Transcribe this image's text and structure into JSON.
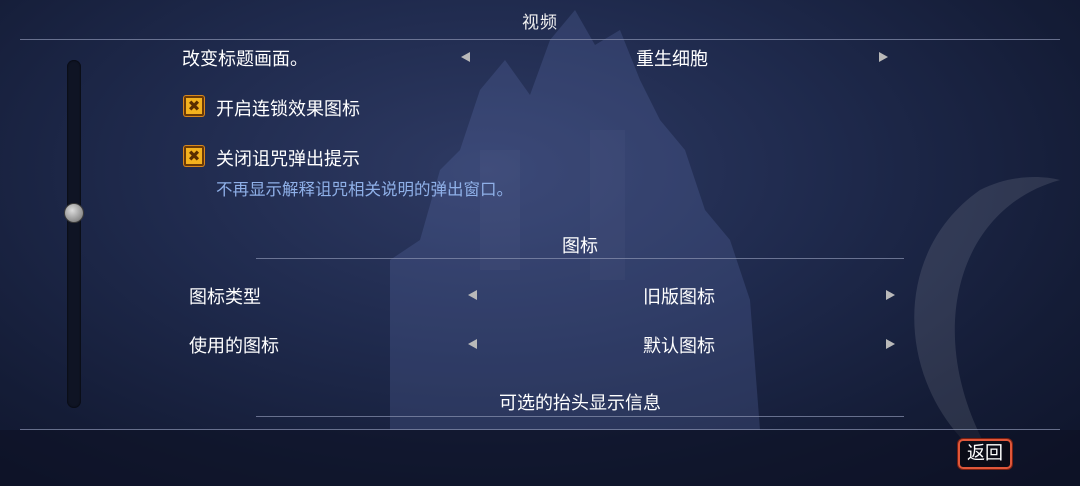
{
  "header": {
    "title": "视频"
  },
  "rows": {
    "title_screen": {
      "label": "改变标题画面。",
      "value": "重生细胞"
    },
    "chain_icons": {
      "label": "开启连锁效果图标",
      "checked": true
    },
    "curse_popup": {
      "label": "关闭诅咒弹出提示",
      "description": "不再显示解释诅咒相关说明的弹出窗口。",
      "checked": true
    }
  },
  "sections": {
    "icons": {
      "title": "图标",
      "icon_type": {
        "label": "图标类型",
        "value": "旧版图标"
      },
      "icon_used": {
        "label": "使用的图标",
        "value": "默认图标"
      }
    },
    "hud": {
      "title": "可选的抬头显示信息"
    }
  },
  "footer": {
    "back_label": "返回"
  },
  "icons": {
    "check_mark": "✖",
    "arrow_left": "triangle-left-icon",
    "arrow_right": "triangle-right-icon"
  },
  "colors": {
    "accent_checkbox": "#f4b21e",
    "description_text": "#8fb0e8",
    "back_border": "#e0573a"
  }
}
